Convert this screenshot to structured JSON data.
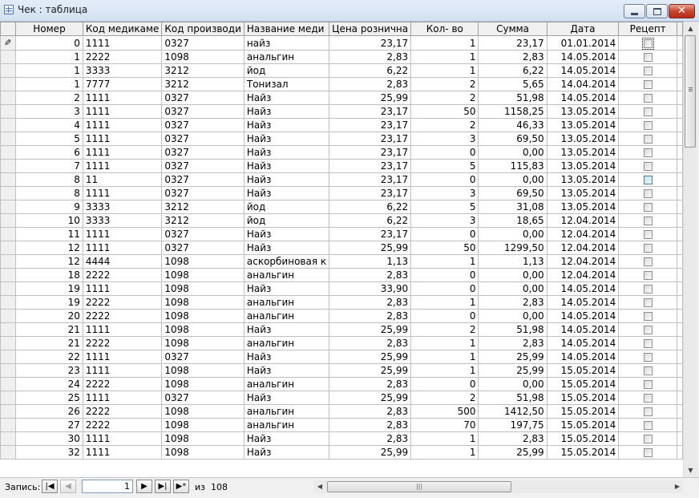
{
  "window": {
    "title": "Чек : таблица"
  },
  "columns": [
    "Номер",
    "Код медикаме",
    "Код производи",
    "Название меди",
    "Цена рознична",
    "Кол- во",
    "Сумма",
    "Дата",
    "Рецепт"
  ],
  "rows": [
    [
      "0",
      "1111",
      "0327",
      "найз",
      "23,17",
      "1",
      "23,17",
      "01.01.2014",
      false
    ],
    [
      "1",
      "2222",
      "1098",
      "анальгин",
      "2,83",
      "1",
      "2,83",
      "14.05.2014",
      false
    ],
    [
      "1",
      "3333",
      "3212",
      "йод",
      "6,22",
      "1",
      "6,22",
      "14.05.2014",
      false
    ],
    [
      "1",
      "7777",
      "3212",
      "Тонизал",
      "2,83",
      "2",
      "5,65",
      "14.04.2014",
      false
    ],
    [
      "2",
      "1111",
      "0327",
      "Найз",
      "25,99",
      "2",
      "51,98",
      "14.05.2014",
      false
    ],
    [
      "3",
      "1111",
      "0327",
      "Найз",
      "23,17",
      "50",
      "1158,25",
      "13.05.2014",
      false
    ],
    [
      "4",
      "1111",
      "0327",
      "Найз",
      "23,17",
      "2",
      "46,33",
      "13.05.2014",
      false
    ],
    [
      "5",
      "1111",
      "0327",
      "Найз",
      "23,17",
      "3",
      "69,50",
      "13.05.2014",
      false
    ],
    [
      "6",
      "1111",
      "0327",
      "Найз",
      "23,17",
      "0",
      "0,00",
      "13.05.2014",
      false
    ],
    [
      "7",
      "1111",
      "0327",
      "Найз",
      "23,17",
      "5",
      "115,83",
      "13.05.2014",
      false
    ],
    [
      "8",
      "11",
      "0327",
      "Найз",
      "23,17",
      "0",
      "0,00",
      "13.05.2014",
      false
    ],
    [
      "8",
      "1111",
      "0327",
      "Найз",
      "23,17",
      "3",
      "69,50",
      "13.05.2014",
      false
    ],
    [
      "9",
      "3333",
      "3212",
      "йод",
      "6,22",
      "5",
      "31,08",
      "13.05.2014",
      false
    ],
    [
      "10",
      "3333",
      "3212",
      "йод",
      "6,22",
      "3",
      "18,65",
      "12.04.2014",
      false
    ],
    [
      "11",
      "1111",
      "0327",
      "Найз",
      "23,17",
      "0",
      "0,00",
      "12.04.2014",
      false
    ],
    [
      "12",
      "1111",
      "0327",
      "Найз",
      "25,99",
      "50",
      "1299,50",
      "12.04.2014",
      false
    ],
    [
      "12",
      "4444",
      "1098",
      "аскорбиновая к",
      "1,13",
      "1",
      "1,13",
      "12.04.2014",
      false
    ],
    [
      "18",
      "2222",
      "1098",
      "анальгин",
      "2,83",
      "0",
      "0,00",
      "12.04.2014",
      false
    ],
    [
      "19",
      "1111",
      "1098",
      "Найз",
      "33,90",
      "0",
      "0,00",
      "14.05.2014",
      false
    ],
    [
      "19",
      "2222",
      "1098",
      "анальгин",
      "2,83",
      "1",
      "2,83",
      "14.05.2014",
      false
    ],
    [
      "20",
      "2222",
      "1098",
      "анальгин",
      "2,83",
      "0",
      "0,00",
      "14.05.2014",
      false
    ],
    [
      "21",
      "1111",
      "1098",
      "Найз",
      "25,99",
      "2",
      "51,98",
      "14.05.2014",
      false
    ],
    [
      "21",
      "2222",
      "1098",
      "анальгин",
      "2,83",
      "1",
      "2,83",
      "14.05.2014",
      false
    ],
    [
      "22",
      "1111",
      "0327",
      "Найз",
      "25,99",
      "1",
      "25,99",
      "14.05.2014",
      false
    ],
    [
      "23",
      "1111",
      "1098",
      "Найз",
      "25,99",
      "1",
      "25,99",
      "15.05.2014",
      false
    ],
    [
      "24",
      "2222",
      "1098",
      "анальгин",
      "2,83",
      "0",
      "0,00",
      "15.05.2014",
      false
    ],
    [
      "25",
      "1111",
      "0327",
      "Найз",
      "25,99",
      "2",
      "51,98",
      "15.05.2014",
      false
    ],
    [
      "26",
      "2222",
      "1098",
      "анальгин",
      "2,83",
      "500",
      "1412,50",
      "15.05.2014",
      false
    ],
    [
      "27",
      "2222",
      "1098",
      "анальгин",
      "2,83",
      "70",
      "197,75",
      "15.05.2014",
      false
    ],
    [
      "30",
      "1111",
      "1098",
      "Найз",
      "2,83",
      "1",
      "2,83",
      "15.05.2014",
      false
    ],
    [
      "32",
      "1111",
      "1098",
      "Найз",
      "25,99",
      "1",
      "25,99",
      "15.05.2014",
      false
    ]
  ],
  "navigation": {
    "label": "Запись:",
    "current_record": "1",
    "of_label": "из",
    "total": "108"
  }
}
